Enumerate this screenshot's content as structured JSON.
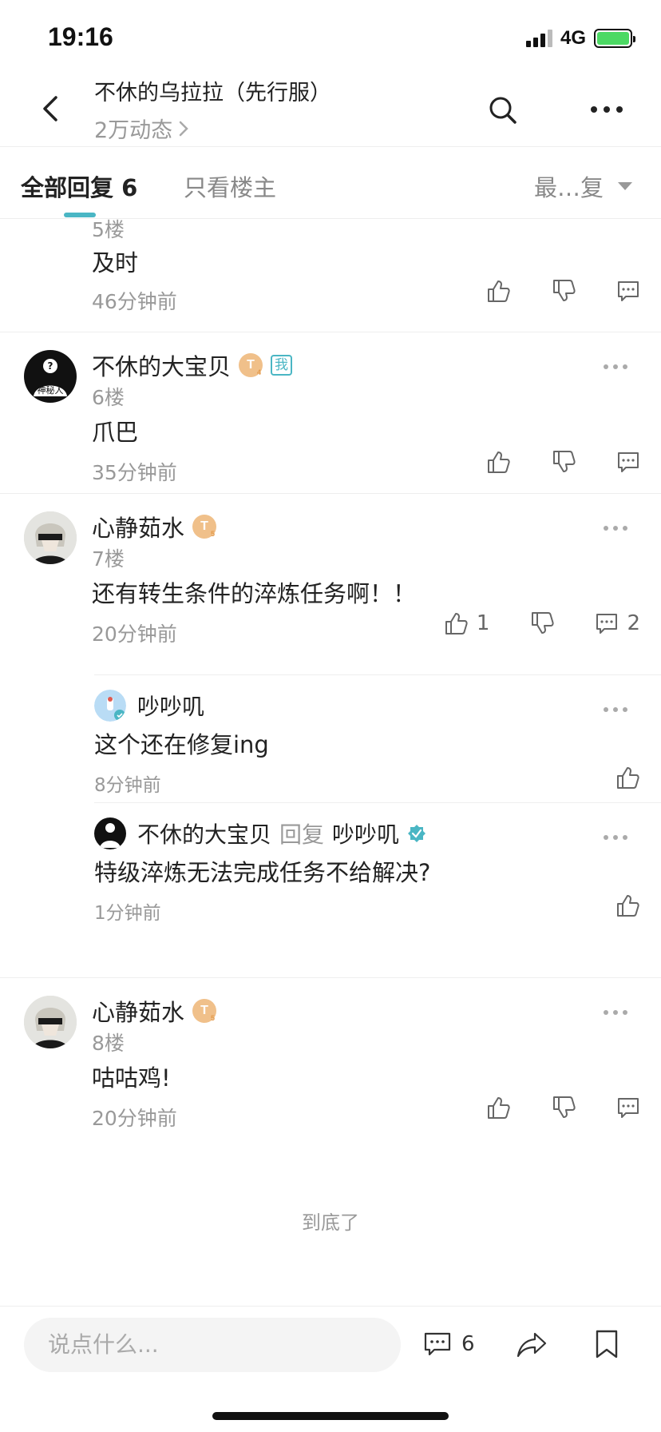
{
  "status": {
    "time": "19:16",
    "network": "4G"
  },
  "header": {
    "title": "不休的乌拉拉（先行服）",
    "subtitle": "2万动态"
  },
  "tabs": {
    "all": "全部回复 6",
    "owner_only": "只看楼主",
    "sort": "最…复"
  },
  "comments": [
    {
      "partial_floor": "5楼",
      "content": "及时",
      "time": "46分钟前"
    },
    {
      "name": "不休的大宝贝",
      "badge": "T",
      "badge_level": "4",
      "me_badge": "我",
      "floor": "6楼",
      "content": "爪巴",
      "time": "35分钟前"
    },
    {
      "name": "心静茹水",
      "badge": "T",
      "badge_level": "5",
      "floor": "7楼",
      "content": "还有转生条件的淬炼任务啊！！",
      "time": "20分钟前",
      "likes": "1",
      "reply_count": "2",
      "replies": [
        {
          "name": "吵吵叽",
          "content": "这个还在修复ing",
          "time": "8分钟前"
        },
        {
          "name": "不休的大宝贝",
          "reply_word": "回复",
          "reply_to": "吵吵叽",
          "content": "特级淬炼无法完成任务不给解决?",
          "time": "1分钟前"
        }
      ]
    },
    {
      "name": "心静茹水",
      "badge": "T",
      "badge_level": "5",
      "floor": "8楼",
      "content": "咕咕鸡!",
      "time": "20分钟前"
    }
  ],
  "mystery_avatar_text": "神秘人",
  "end_text": "到底了",
  "bottom": {
    "input_placeholder": "说点什么...",
    "comment_count": "6"
  },
  "colors": {
    "accent": "#4ab6c4",
    "badge": "#f0c08a",
    "battery": "#4cd964"
  },
  "icons": [
    "back-icon",
    "search-icon",
    "more-icon",
    "like-icon",
    "dislike-icon",
    "comment-icon",
    "share-icon",
    "bookmark-icon",
    "verified-icon",
    "caret-down-icon"
  ]
}
